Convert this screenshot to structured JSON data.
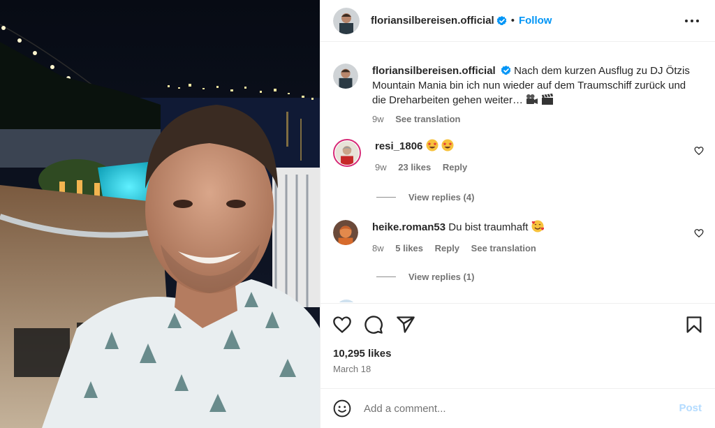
{
  "post": {
    "username": "floriansilbereisen.official",
    "follow_label": "Follow",
    "separator": "•"
  },
  "caption": {
    "username": "floriansilbereisen.official",
    "text": "Nach dem kurzen Ausflug zu DJ Ötzis Mountain Mania bin ich nun wieder auf dem Traumschiff zurück und die Dreharbeiten gehen weiter…",
    "emojis": [
      "film-camera",
      "clapper-board"
    ],
    "age": "9w",
    "translate_label": "See translation"
  },
  "comments": [
    {
      "username": "resi_1806",
      "emojis": [
        "star-struck",
        "star-struck"
      ],
      "age": "9w",
      "likes": "23 likes",
      "reply_label": "Reply",
      "view_replies": "View replies (4)"
    },
    {
      "username": "heike.roman53",
      "text": "Du bist traumhaft",
      "emojis": [
        "smiling-face-with-hearts"
      ],
      "age": "8w",
      "likes": "5 likes",
      "reply_label": "Reply",
      "translate_label": "See translation",
      "view_replies": "View replies (1)"
    }
  ],
  "stats": {
    "likes": "10,295 likes",
    "date": "March 18"
  },
  "composer": {
    "placeholder": "Add a comment...",
    "post_label": "Post"
  },
  "icons": [
    "verified-badge-icon",
    "more-options-icon",
    "heart-icon",
    "comment-icon",
    "share-icon",
    "save-icon",
    "emoji-icon"
  ],
  "colors": {
    "link_blue": "#0095f6",
    "verified_blue": "#0095f6",
    "text": "#262626",
    "secondary_text": "#737373",
    "post_disabled": "#b3dbff"
  }
}
